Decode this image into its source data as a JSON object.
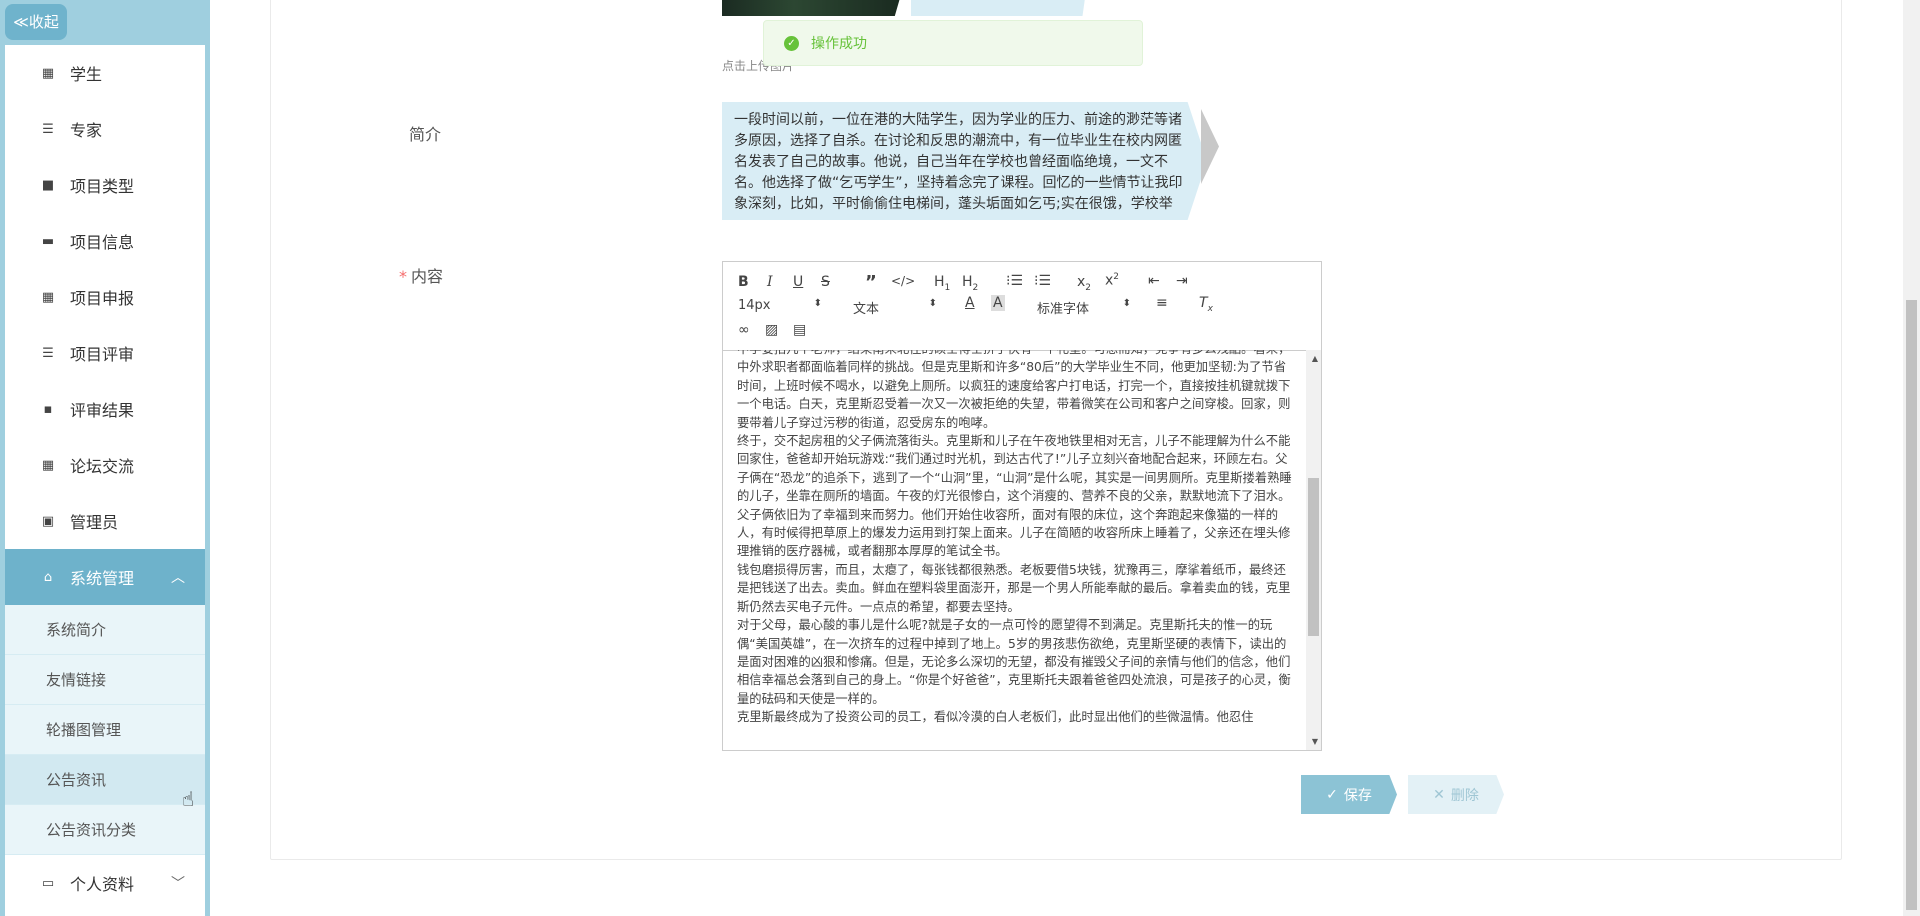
{
  "sidebar": {
    "collapse_label": "≪收起",
    "items": [
      {
        "label": "学生",
        "icon": "grid-icon"
      },
      {
        "label": "专家",
        "icon": "list-icon"
      },
      {
        "label": "项目类型",
        "icon": "briefcase-icon"
      },
      {
        "label": "项目信息",
        "icon": "monitor-icon"
      },
      {
        "label": "项目申报",
        "icon": "grid-icon"
      },
      {
        "label": "项目评审",
        "icon": "list-icon"
      },
      {
        "label": "评审结果",
        "icon": "comment-icon"
      },
      {
        "label": "论坛交流",
        "icon": "grid-icon"
      },
      {
        "label": "管理员",
        "icon": "clipboard-icon"
      }
    ],
    "system": {
      "label": "系统管理",
      "subitems": [
        "系统简介",
        "友情链接",
        "轮播图管理",
        "公告资讯",
        "公告资讯分类"
      ]
    },
    "profile_label": "个人资料"
  },
  "form": {
    "upload_hint": "点击上传图片",
    "intro_label": "简介",
    "intro_text": "一段时间以前，一位在港的大陆学生，因为学业的压力、前途的渺茫等诸多原因，选择了自杀。在讨论和反思的潮流中，有一位毕业生在校内网匿名发表了自己的故事。他说，自己当年在学校也曾经面临绝境，一文不名。他选择了做“乞丐学生”，坚持着念完了课程。回忆的一些情节让我印象深刻，比如，平时偷偷住电梯间，蓬头垢面如乞丐;实在很饿，学校举",
    "content_label": "内容",
    "required_mark": "*"
  },
  "toast": {
    "text": "操作成功"
  },
  "editor": {
    "size_select": "14px",
    "type_select": "文本",
    "font_select": "标准字体",
    "paragraphs": [
      "中学要招几个老师，结果南来北往的硕士博士挤了快有一个礼堂。可想而知，竞争有多么残酷。看来，中外求职者都面临着同样的挑战。但是克里斯和许多“80后”的大学毕业生不同，他更加坚韧:为了节省时间，上班时候不喝水，以避免上厕所。以疯狂的速度给客户打电话，打完一个，直接按挂机键就拨下一个电话。白天，克里斯忍受着一次又一次被拒绝的失望，带着微笑在公司和客户之间穿梭。回家，则要带着儿子穿过污秽的街道，忍受房东的咆哮。",
      "终于，交不起房租的父子俩流落街头。克里斯和儿子在午夜地铁里相对无言，儿子不能理解为什么不能回家住，爸爸却开始玩游戏:“我们通过时光机，到达古代了!”儿子立刻兴奋地配合起来，环顾左右。父子俩在“恐龙”的追杀下，逃到了一个“山洞”里，“山洞”是什么呢，其实是一间男厕所。克里斯搂着熟睡的儿子，坐靠在厕所的墙面。午夜的灯光很惨白，这个消瘦的、营养不良的父亲，默默地流下了泪水。",
      "父子俩依旧为了幸福到来而努力。他们开始住收容所，面对有限的床位，这个奔跑起来像猫的一样的人，有时候得把草原上的爆发力运用到打架上面来。儿子在简陋的收容所床上睡着了，父亲还在埋头修理推销的医疗器械，或者翻那本厚厚的笔试全书。",
      "钱包磨损得厉害，而且，太瘪了，每张钱都很熟悉。老板要借5块钱，犹豫再三，摩挲着纸币，最终还是把钱送了出去。卖血。鲜血在塑料袋里面澎开，那是一个男人所能奉献的最后。拿着卖血的钱，克里斯仍然去买电子元件。一点点的希望，都要去坚持。",
      "对于父母，最心酸的事儿是什么呢?就是子女的一点可怜的愿望得不到满足。克里斯托夫的惟一的玩偶“美国英雄”，在一次挤车的过程中掉到了地上。5岁的男孩悲伤欲绝，克里斯坚硬的表情下，读出的是面对困难的凶狠和惨痛。但是，无论多么深切的无望，都没有摧毁父子间的亲情与他们的信念，他们相信幸福总会落到自己的身上。“你是个好爸爸”，克里斯托夫跟着爸爸四处流浪，可是孩子的心灵，衡量的砝码和天使是一样的。",
      "克里斯最终成为了投资公司的员工，看似冷漠的白人老板们，此时显出他们的些微温情。他忍住"
    ]
  },
  "buttons": {
    "save_label": "保存",
    "delete_label": "删除"
  },
  "colors": {
    "accent": "#6eb2cb",
    "sidebar_bg": "#9fcfdf",
    "success": "#67c23a"
  }
}
